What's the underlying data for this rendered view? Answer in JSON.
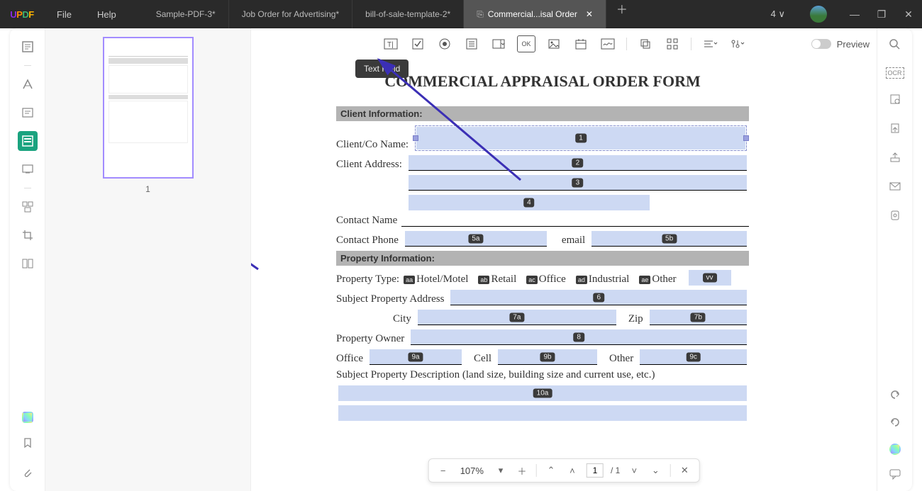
{
  "titlebar": {
    "menus": [
      "File",
      "Help"
    ],
    "tabs": [
      {
        "label": "Sample-PDF-3*"
      },
      {
        "label": "Job Order for Advertising*"
      },
      {
        "label": "bill-of-sale-template-2*"
      },
      {
        "label": "Commercial...isal Order",
        "active": true
      }
    ],
    "page_indicator": "4",
    "win": {
      "min": "—",
      "max": "❐",
      "close": "✕"
    }
  },
  "left_rail": {
    "items": [
      "reader",
      "annotate",
      "edit",
      "form",
      "slideshow",
      "organize",
      "crop",
      "compare"
    ],
    "bottom": [
      "layers",
      "bookmark",
      "attach"
    ]
  },
  "right_rail": {
    "items": [
      "search",
      "ocr",
      "scan",
      "export",
      "share",
      "mail",
      "cloud"
    ],
    "bottom": [
      "undo",
      "redo",
      "assistant",
      "comment"
    ]
  },
  "thumbs": {
    "page_num": "1"
  },
  "form_toolbar": {
    "items": [
      "text-field",
      "checkbox",
      "radio",
      "list",
      "dropdown",
      "button",
      "image",
      "date",
      "signature"
    ],
    "group2": [
      "duplicate",
      "grid"
    ],
    "group3": [
      "align",
      "properties"
    ],
    "preview_label": "Preview",
    "tooltip": "Text Field"
  },
  "doc": {
    "title": "COMMERCIAL APPRAISAL ORDER FORM",
    "section1": "Client Information:",
    "client_name_lbl": "Client/Co Name:",
    "client_addr_lbl": "Client Address:",
    "contact_name_lbl": "Contact Name",
    "contact_phone_lbl": "Contact Phone",
    "email_lbl": "email",
    "section2": "Property Information:",
    "prop_type_lbl": "Property Type:",
    "prop_types": {
      "aa": "Hotel/Motel",
      "ab": "Retail",
      "ac": "Office",
      "ad": "Industrial",
      "ae": "Other",
      "vv": "vv"
    },
    "subj_addr_lbl": "Subject Property Address",
    "city_lbl": "City",
    "zip_lbl": "Zip",
    "owner_lbl": "Property Owner",
    "office_lbl": "Office",
    "cell_lbl": "Cell",
    "other_lbl": "Other",
    "desc_lbl": "Subject Property Description (land size, building size and current use, etc.)",
    "tags": {
      "f1": "1",
      "f2": "2",
      "f3": "3",
      "f4": "4",
      "f5a": "5a",
      "f5b": "5b",
      "f6": "6",
      "f7a": "7a",
      "f7b": "7b",
      "f8": "8",
      "f9a": "9a",
      "f9b": "9b",
      "f9c": "9c",
      "f10a": "10a"
    }
  },
  "bottom_nav": {
    "zoom": "107%",
    "page": "1",
    "total": "/  1"
  }
}
